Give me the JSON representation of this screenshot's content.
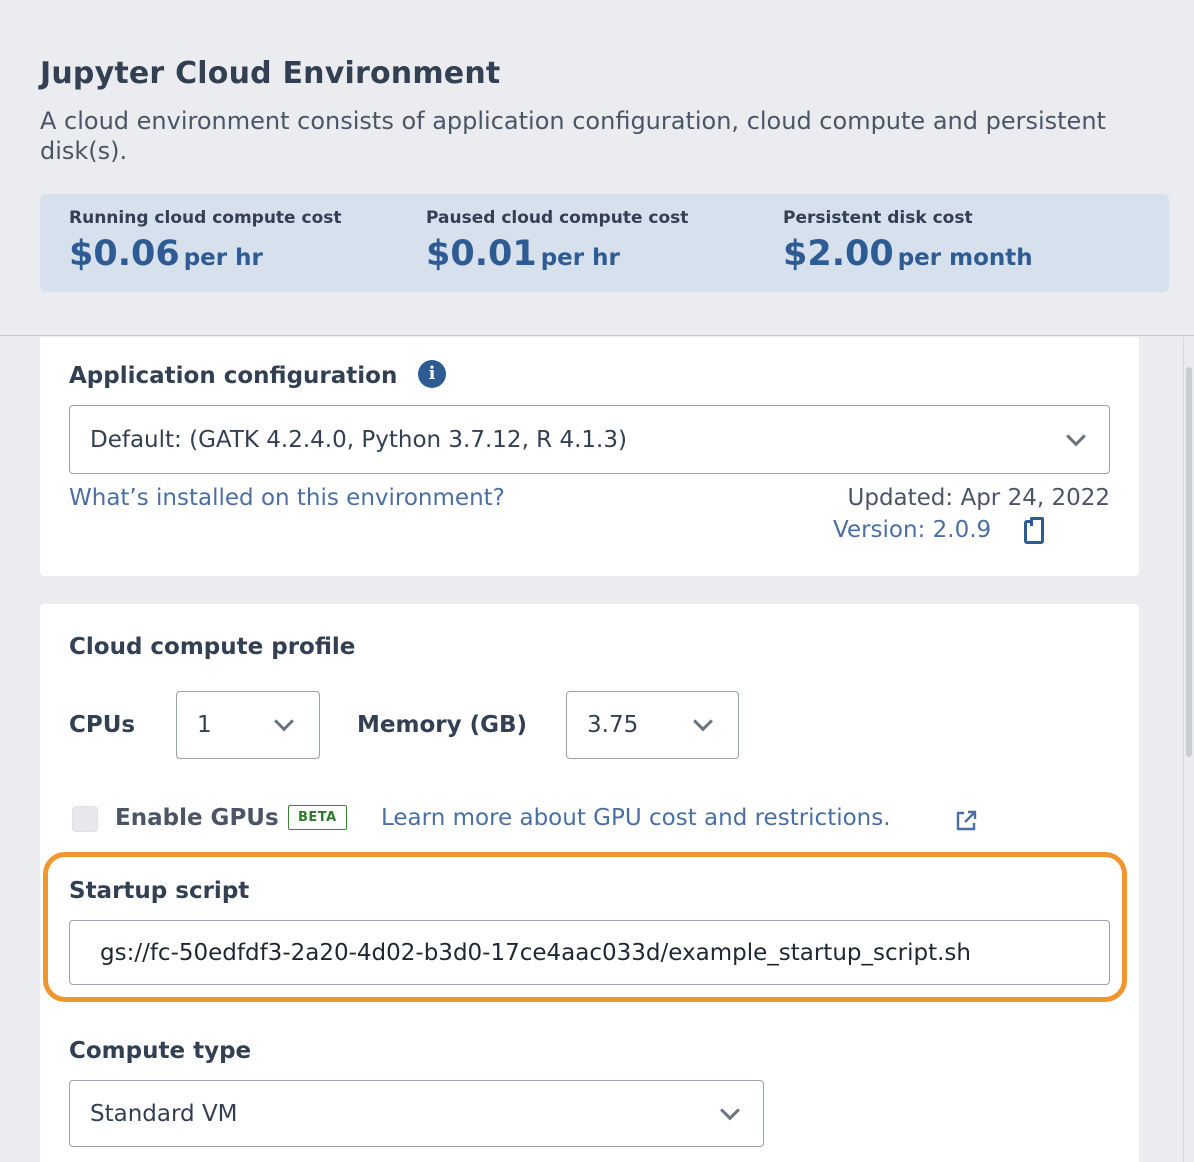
{
  "header": {
    "title": "Jupyter Cloud Environment",
    "subtitle": "A cloud environment consists of application configuration, cloud compute and persistent disk(s)."
  },
  "costs": [
    {
      "label": "Running cloud compute cost",
      "amount": "$0.06",
      "unit": "per hr"
    },
    {
      "label": "Paused cloud compute cost",
      "amount": "$0.01",
      "unit": "per hr"
    },
    {
      "label": "Persistent disk cost",
      "amount": "$2.00",
      "unit": "per month"
    }
  ],
  "app_config": {
    "label": "Application configuration",
    "info_icon": "i",
    "selected": "Default: (GATK 4.2.4.0, Python 3.7.12, R 4.1.3)",
    "whats_installed_link": "What’s installed on this environment?",
    "updated": "Updated: Apr 24, 2022",
    "version": "Version: 2.0.9"
  },
  "compute_profile": {
    "label": "Cloud compute profile",
    "cpus_label": "CPUs",
    "cpus_value": "1",
    "memory_label": "Memory (GB)",
    "memory_value": "3.75",
    "enable_gpus_label": "Enable GPUs",
    "enable_gpus_checked": false,
    "beta_badge": "BETA",
    "gpu_link": "Learn more about GPU cost and restrictions."
  },
  "startup_script": {
    "label": "Startup script",
    "value": "gs://fc-50edfdf3-2a20-4d02-b3d0-17ce4aac033d/example_startup_script.sh"
  },
  "compute_type": {
    "label": "Compute type",
    "selected": "Standard VM"
  },
  "colors": {
    "accent": "#2f5b94",
    "highlight": "#f0962e",
    "beta": "#2e7a2b"
  }
}
